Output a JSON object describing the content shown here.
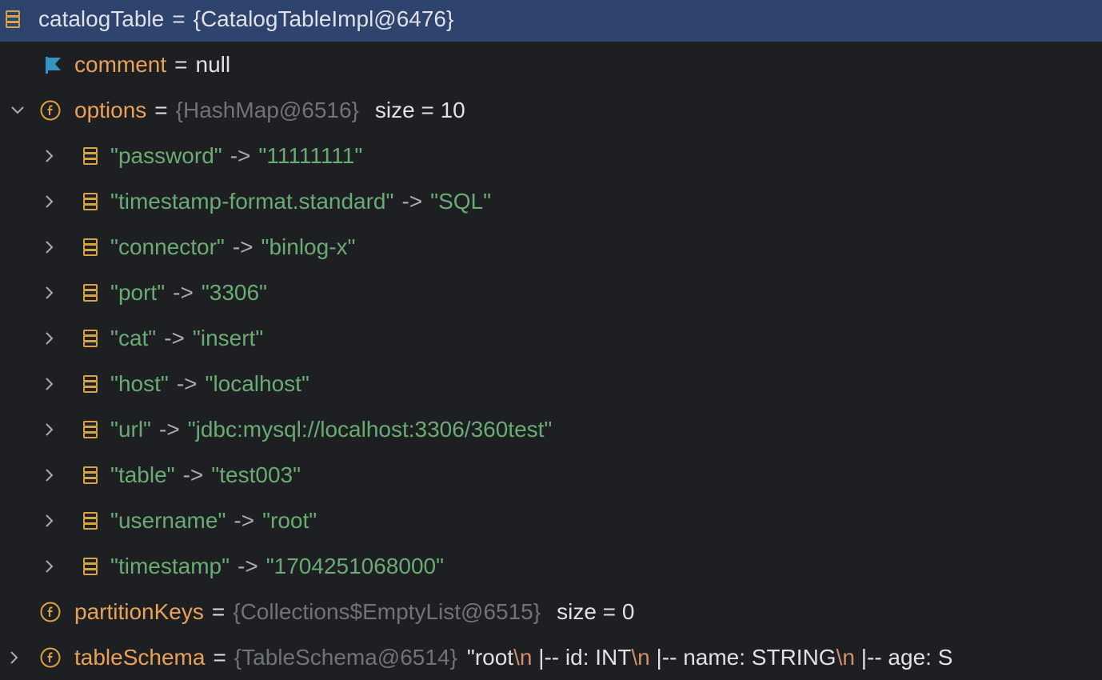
{
  "colors": {
    "background": "#1e1f22",
    "selection": "#2e436e",
    "field_name": "#e9a15a",
    "string_value": "#6aab73",
    "reference": "#6f737a",
    "escape": "#cf8e6d",
    "field_icon": "#d9a343",
    "flag_icon": "#3592c4"
  },
  "root": {
    "icon": "map-entry-icon",
    "name": "catalogTable",
    "op": "=",
    "value": "{CatalogTableImpl@6476}"
  },
  "comment": {
    "icon": "flag-icon",
    "name": "comment",
    "op": "=",
    "value": "null"
  },
  "options": {
    "expanded": true,
    "icon": "field-icon",
    "name": "options",
    "op": "=",
    "ref": "{HashMap@6516}",
    "size_text": "size = 10",
    "entries": [
      {
        "key": "\"password\"",
        "arrow": "->",
        "value": "\"11111111\""
      },
      {
        "key": "\"timestamp-format.standard\"",
        "arrow": "->",
        "value": "\"SQL\""
      },
      {
        "key": "\"connector\"",
        "arrow": "->",
        "value": "\"binlog-x\""
      },
      {
        "key": "\"port\"",
        "arrow": "->",
        "value": "\"3306\""
      },
      {
        "key": "\"cat\"",
        "arrow": "->",
        "value": "\"insert\""
      },
      {
        "key": "\"host\"",
        "arrow": "->",
        "value": "\"localhost\""
      },
      {
        "key": "\"url\"",
        "arrow": "->",
        "value": "\"jdbc:mysql://localhost:3306/360test\""
      },
      {
        "key": "\"table\"",
        "arrow": "->",
        "value": "\"test003\""
      },
      {
        "key": "\"username\"",
        "arrow": "->",
        "value": "\"root\""
      },
      {
        "key": "\"timestamp\"",
        "arrow": "->",
        "value": "\"1704251068000\""
      }
    ]
  },
  "partitionKeys": {
    "icon": "field-icon",
    "name": "partitionKeys",
    "op": "=",
    "ref": "{Collections$EmptyList@6515}",
    "size_text": "size = 0"
  },
  "tableSchema": {
    "icon": "field-icon",
    "name": "tableSchema",
    "op": "=",
    "ref": "{TableSchema@6514}",
    "seg1": "\"root",
    "esc1": "\\n",
    "seg2": " |-- id: INT",
    "esc2": "\\n",
    "seg3": " |-- name: STRING",
    "esc3": "\\n",
    "seg4": " |-- age: S"
  }
}
